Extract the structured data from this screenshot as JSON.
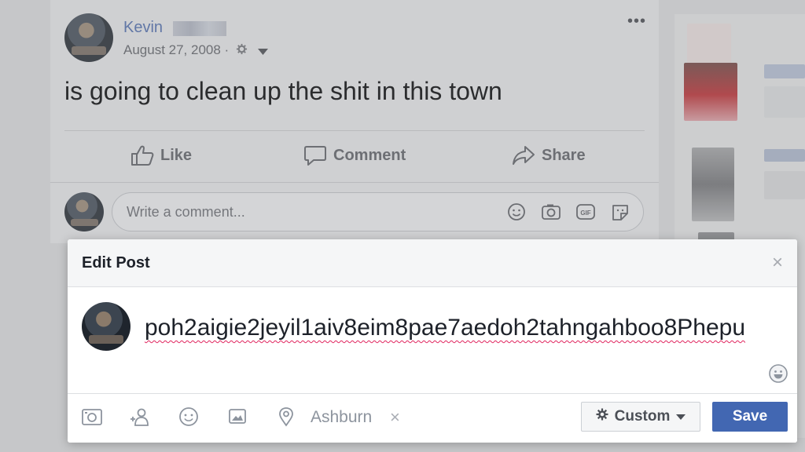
{
  "post": {
    "author_first_name": "Kevin",
    "date": "August 27, 2008 ·",
    "menu": "•••",
    "text": "is going to clean up the shit in this town",
    "actions": {
      "like": "Like",
      "comment": "Comment",
      "share": "Share"
    },
    "comment_placeholder": "Write a comment..."
  },
  "modal": {
    "title": "Edit Post",
    "close": "×",
    "composer_text": "poh2aigie2jeyil1aiv8eim8pae7aedoh2tahngahboo8Phepu",
    "location": "Ashburn",
    "location_remove": "×",
    "privacy_label": "Custom",
    "save_label": "Save"
  },
  "colors": {
    "accent": "#4267b2",
    "spellcheck": "#e0245e",
    "link": "#3d5a98"
  }
}
